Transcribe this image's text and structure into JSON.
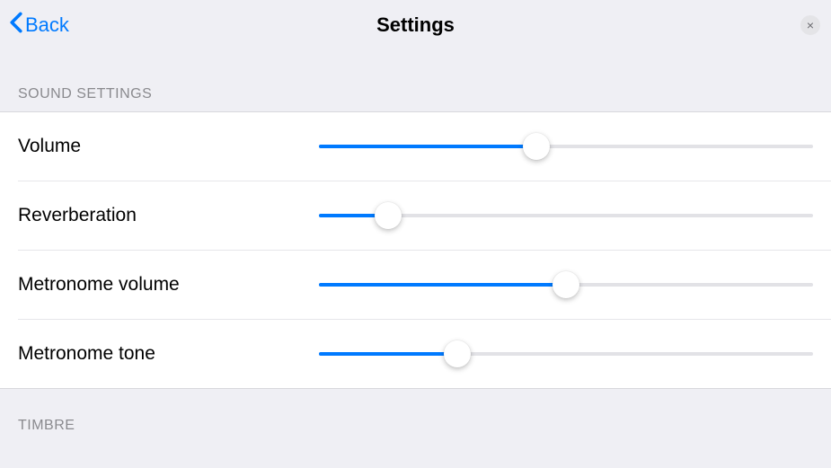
{
  "nav": {
    "back_label": "Back",
    "title": "Settings",
    "close_label": "×"
  },
  "sections": {
    "sound": {
      "header": "Sound Settings",
      "rows": {
        "volume": {
          "label": "Volume",
          "value": 44
        },
        "reverb": {
          "label": "Reverberation",
          "value": 14
        },
        "metronome_volume": {
          "label": "Metronome volume",
          "value": 50
        },
        "metronome_tone": {
          "label": "Metronome tone",
          "value": 28
        }
      }
    },
    "timbre": {
      "header": "Timbre"
    }
  },
  "colors": {
    "accent": "#007aff",
    "background": "#efeff4",
    "list_bg": "#ffffff"
  }
}
